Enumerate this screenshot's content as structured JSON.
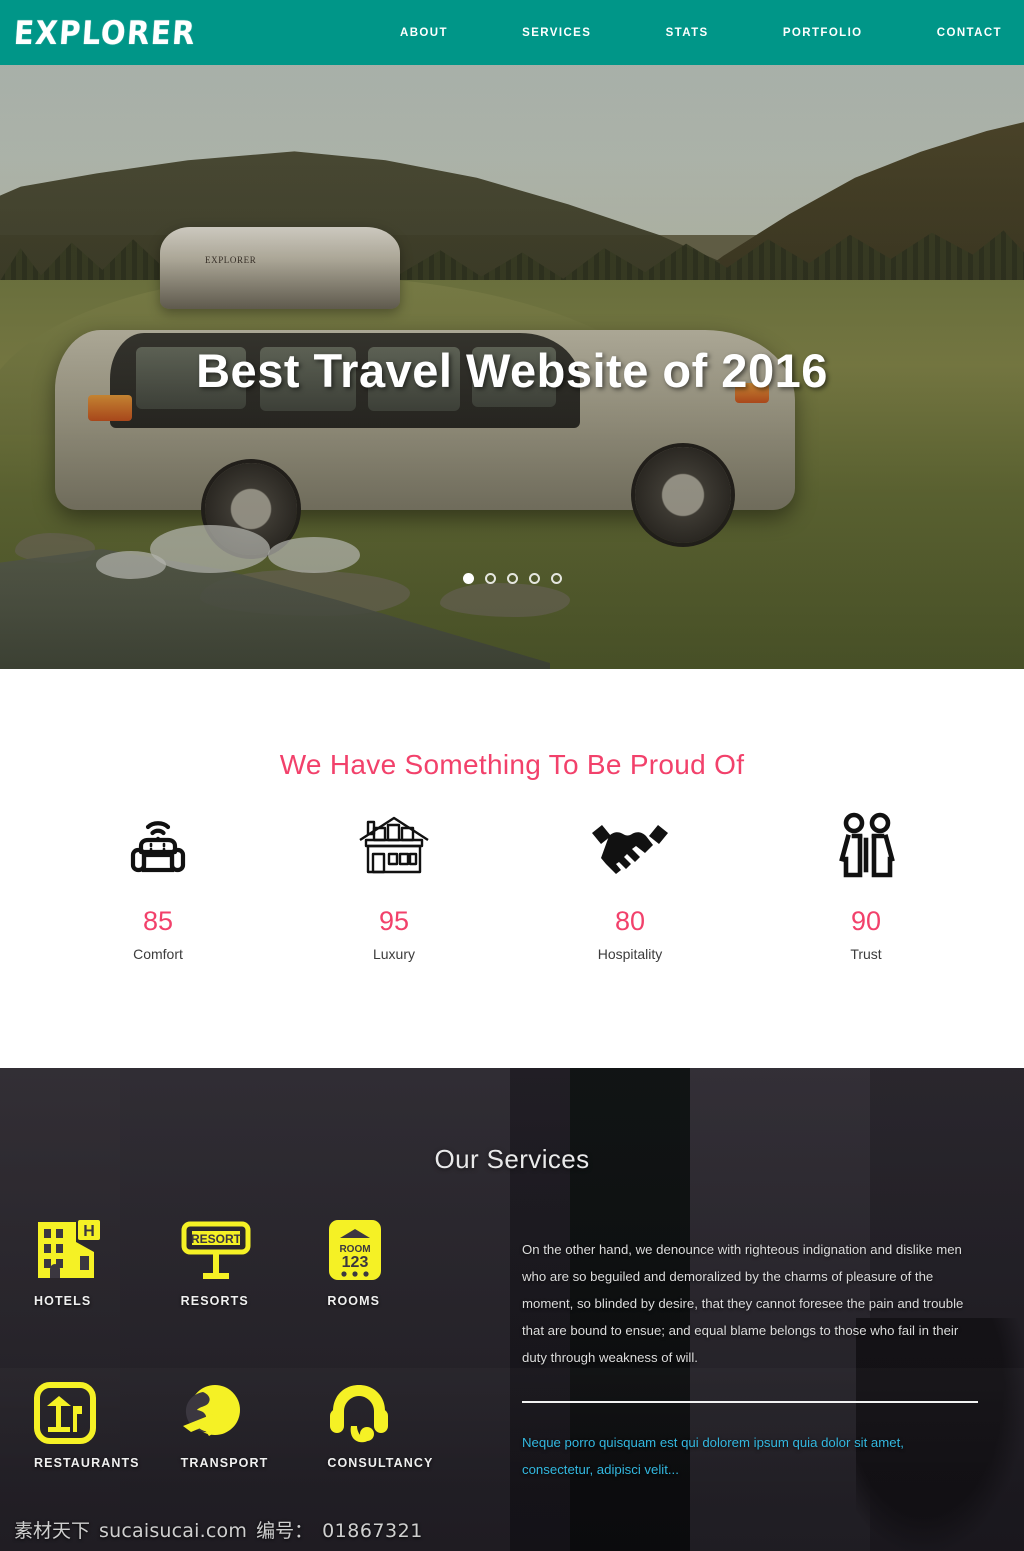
{
  "header": {
    "logo": "EXPLORER",
    "nav": [
      {
        "label": "ABOUT",
        "name": "nav-item-about"
      },
      {
        "label": "SERVICES",
        "name": "nav-item-services"
      },
      {
        "label": "STATS",
        "name": "nav-item-stats"
      },
      {
        "label": "PORTFOLIO",
        "name": "nav-item-portfolio"
      },
      {
        "label": "CONTACT",
        "name": "nav-item-contact"
      }
    ],
    "brand_color": "#009688"
  },
  "hero": {
    "title": "Best Travel Website of 2016",
    "car_box_label": "EXPLORER",
    "carousel": {
      "total": 5,
      "active_index": 0
    }
  },
  "stats": {
    "title": "We Have Something To Be Proud Of",
    "accent_color": "#f2416b",
    "items": [
      {
        "icon": "armchair-wifi-icon",
        "value": "85",
        "label": "Comfort"
      },
      {
        "icon": "house-icon",
        "value": "95",
        "label": "Luxury"
      },
      {
        "icon": "handshake-icon",
        "value": "80",
        "label": "Hospitality"
      },
      {
        "icon": "two-people-icon",
        "value": "90",
        "label": "Trust"
      }
    ]
  },
  "services": {
    "title": "Our Services",
    "icon_color": "#f5f125",
    "items": [
      {
        "icon": "hotel-building-icon",
        "label": "HOTELS"
      },
      {
        "icon": "resort-sign-icon",
        "label": "RESORTS"
      },
      {
        "icon": "room-placard-icon",
        "label": "ROOMS"
      },
      {
        "icon": "restaurant-icon",
        "label": "RESTAURANTS"
      },
      {
        "icon": "globe-plane-icon",
        "label": "TRANSPORT"
      },
      {
        "icon": "headset-icon",
        "label": "CONSULTANCY"
      }
    ],
    "paragraph": "On the other hand, we denounce with righteous indignation and dislike men who are so beguiled and demoralized by the charms of pleasure of the moment, so blinded by desire, that they cannot foresee the pain and trouble that are bound to ensue; and equal blame belongs to those who fail in their duty through weakness of will.",
    "quote": "Neque porro quisquam est qui dolorem ipsum quia dolor sit amet, consectetur, adipisci velit...",
    "quote_color": "#33b8e0",
    "resort_sign_text": "RESORT",
    "room_text_top": "ROOM",
    "room_text_num": "123",
    "hotel_letter": "H"
  },
  "watermark": {
    "site_cn": "素材天下",
    "site": "sucaisucai.com",
    "number_label": "编号：",
    "number": "01867321"
  }
}
